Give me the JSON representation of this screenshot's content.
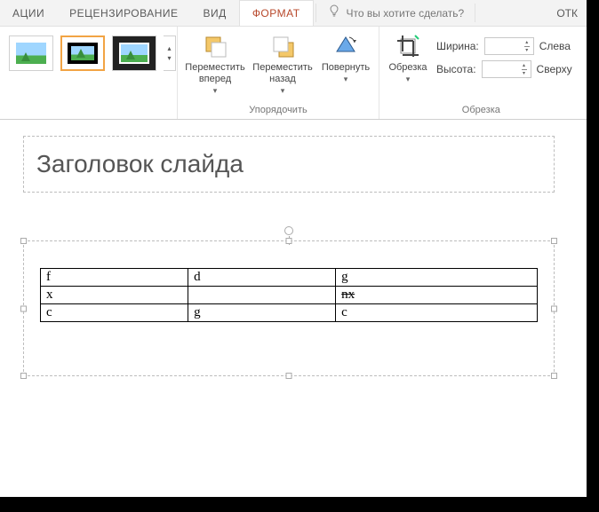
{
  "tabs": {
    "animations": "АЦИИ",
    "review": "РЕЦЕНЗИРОВАНИЕ",
    "view": "ВИД",
    "format": "ФОРМАТ",
    "tellme_placeholder": "Что вы хотите сделать?",
    "right_partial": "ОТК"
  },
  "ribbon": {
    "arrange": {
      "bring_forward": "Переместить вперед",
      "send_backward": "Переместить назад",
      "rotate": "Повернуть",
      "group_label": "Упорядочить"
    },
    "crop": {
      "crop": "Обрезка",
      "width_label": "Ширина:",
      "height_label": "Высота:",
      "left_label": "Слева",
      "top_label": "Сверху",
      "group_label": "Обрезка"
    }
  },
  "slide": {
    "title": "Заголовок слайда",
    "table": [
      [
        "f",
        "d",
        "g"
      ],
      [
        "x",
        "",
        "nx"
      ],
      [
        "c",
        "g",
        "c"
      ]
    ]
  }
}
